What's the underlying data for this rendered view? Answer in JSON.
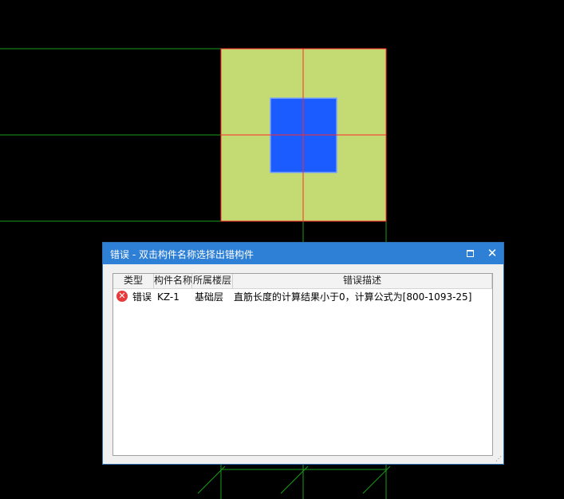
{
  "dialog": {
    "title": "错误 - 双击构件名称选择出错构件",
    "maximize_label": "",
    "close_label": "✕"
  },
  "table": {
    "columns": [
      "类型",
      "构件名称",
      "所属楼层",
      "错误描述"
    ],
    "rows": [
      {
        "icon": "error-icon",
        "type": "错误",
        "name": "KZ-1",
        "floor": "基础层",
        "description": "直筋长度的计算结果小于0，计算公式为[800-1093-25]"
      }
    ]
  },
  "colors": {
    "canvas_bg": "#000000",
    "foundation_fill": "#c4da72",
    "column_fill": "#1a5cff",
    "axis_line": "#ff2a2a",
    "grid_line": "#1a9a1a",
    "titlebar": "#2e7fd6"
  }
}
